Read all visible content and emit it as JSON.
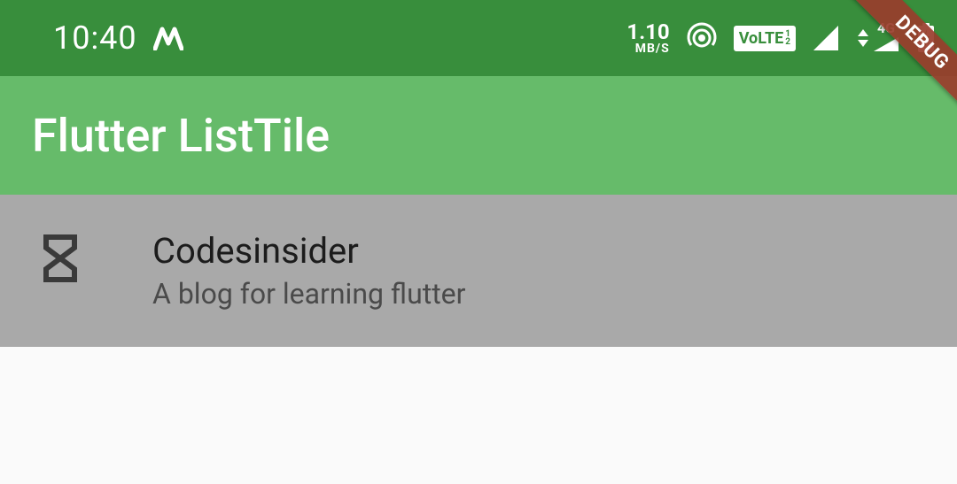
{
  "status_bar": {
    "time": "10:40",
    "net_speed_value": "1.10",
    "net_speed_unit": "MB/S",
    "volte_label": "VoLTE",
    "volte_sim": "1\n2",
    "signal_4g": "4G"
  },
  "app_bar": {
    "title": "Flutter ListTile"
  },
  "list_tile": {
    "title": "Codesinsider",
    "subtitle": "A blog for learning flutter"
  },
  "debug_banner": "DEBUG"
}
